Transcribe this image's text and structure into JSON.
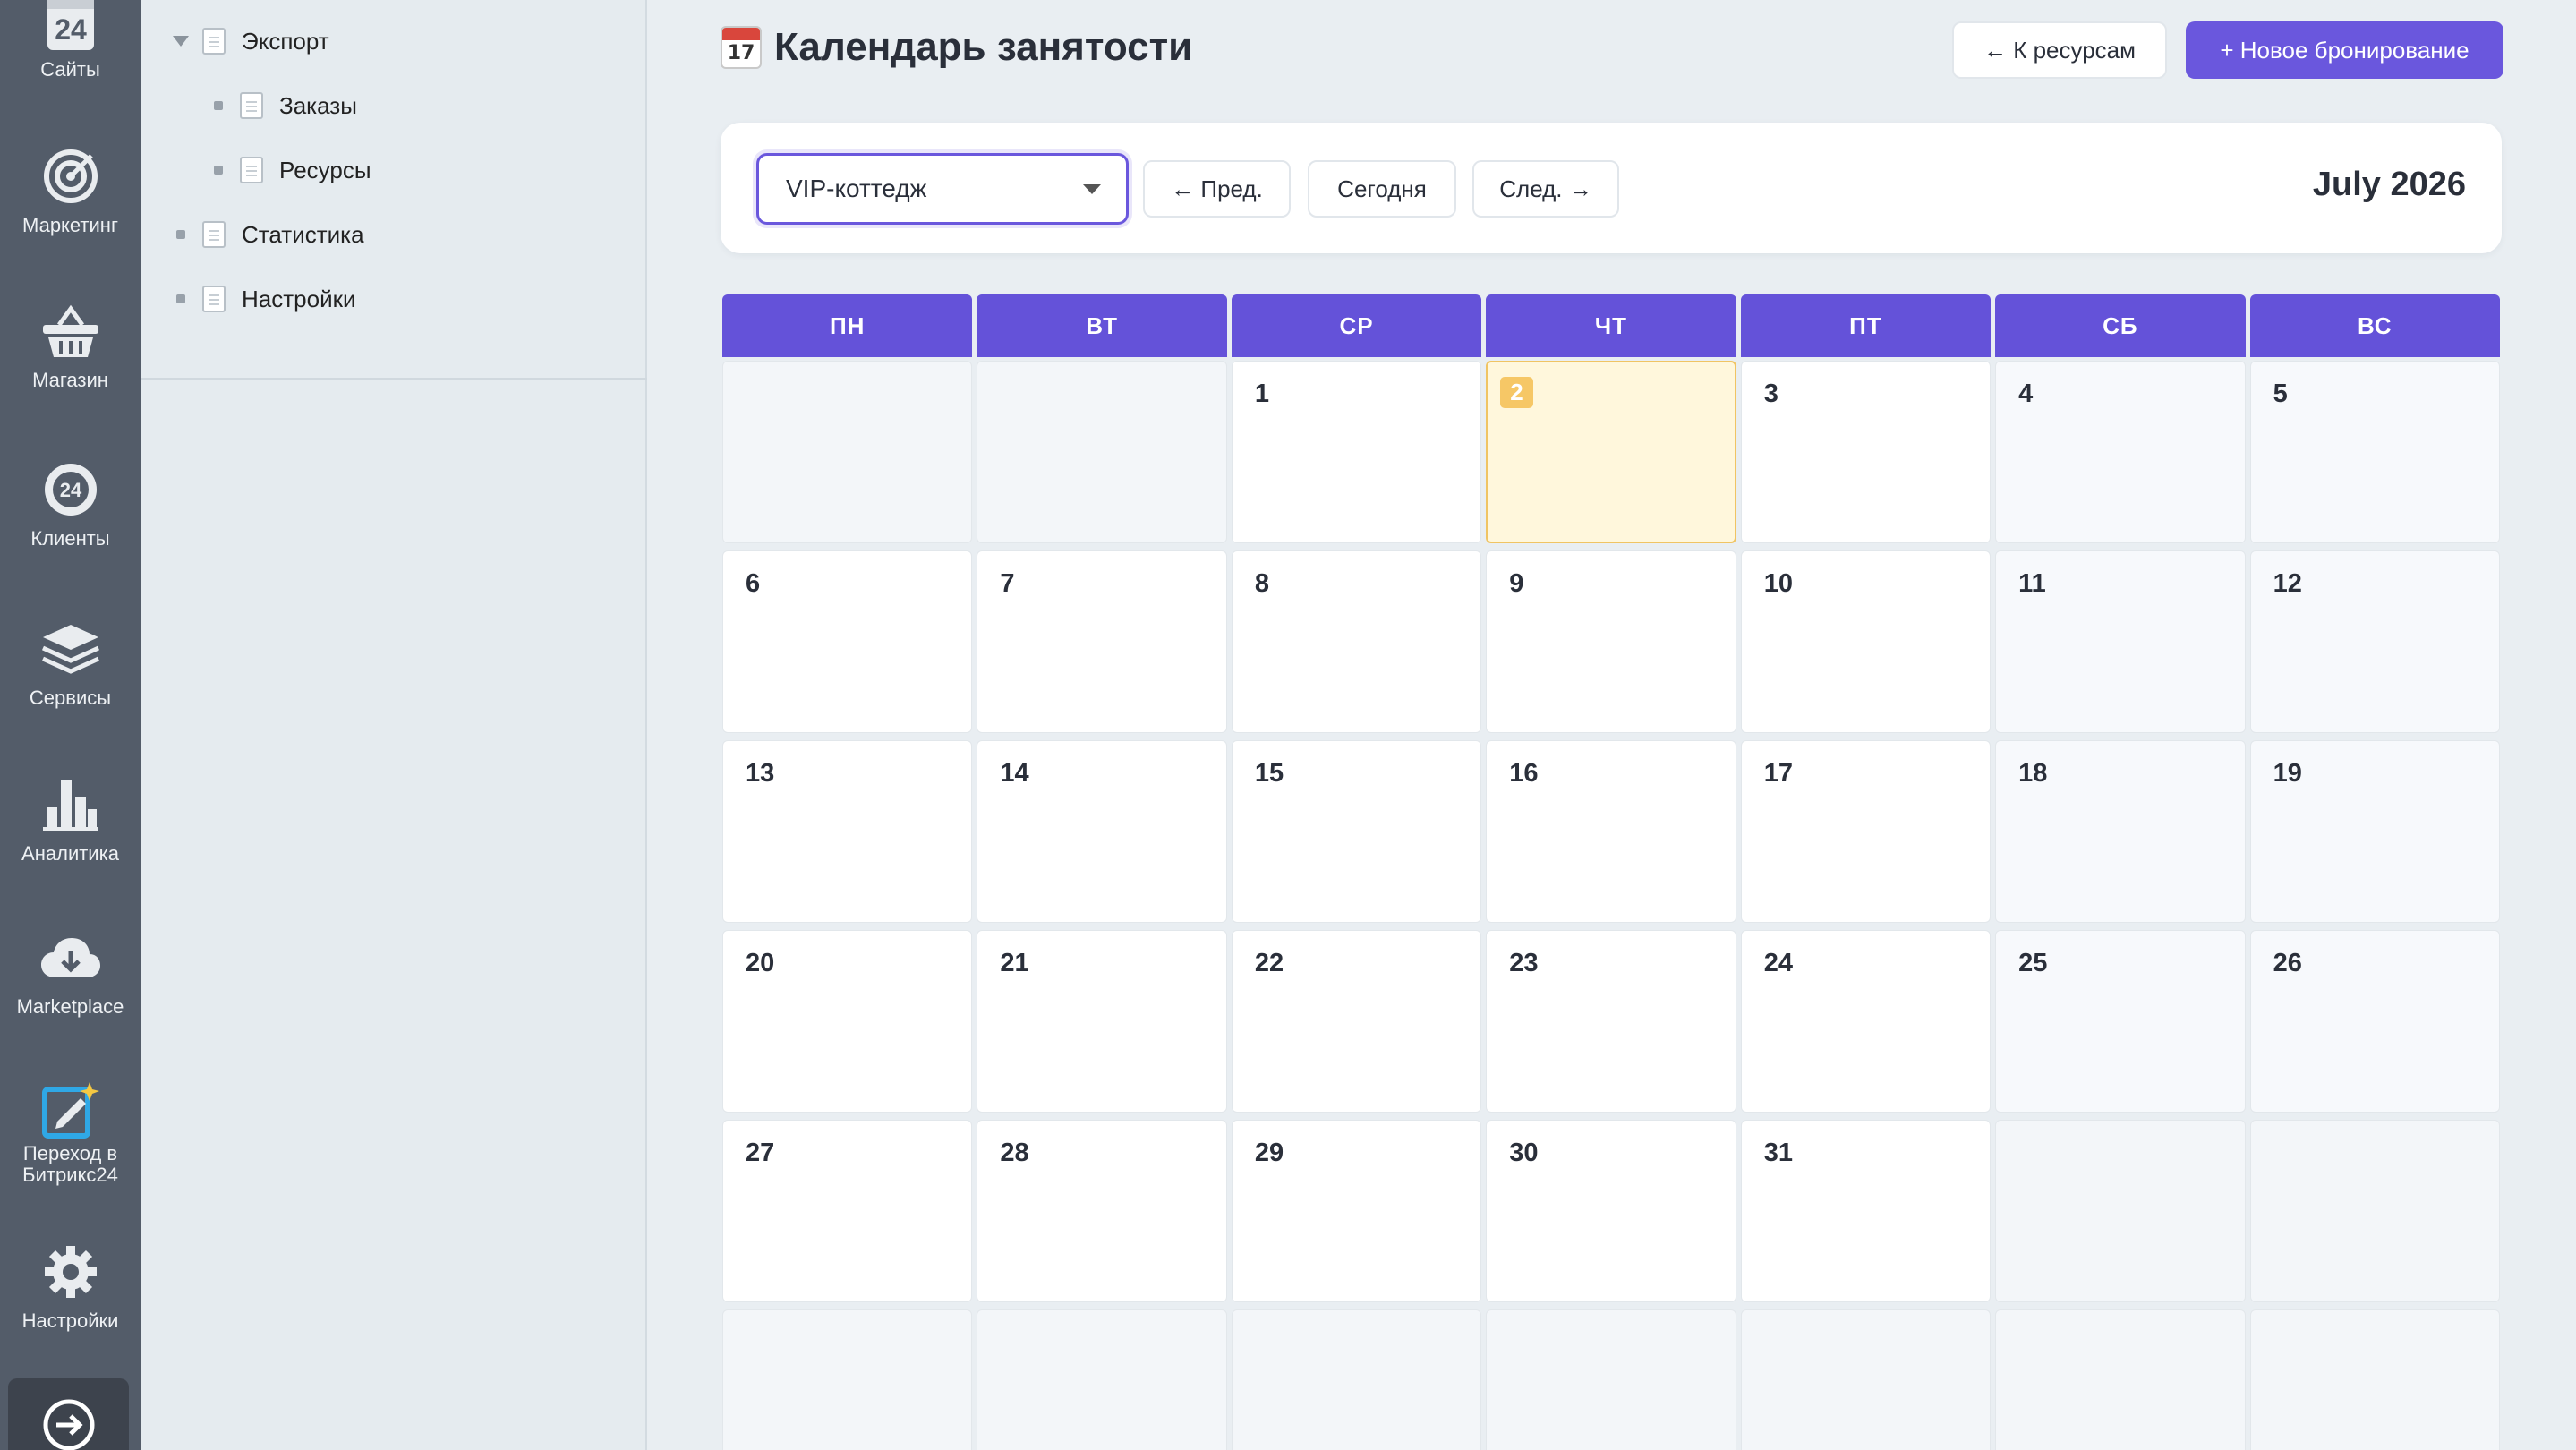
{
  "rail": {
    "items": [
      {
        "label": "Сайты",
        "icon": "calendar-24-icon"
      },
      {
        "label": "Маркетинг",
        "icon": "target-icon"
      },
      {
        "label": "Магазин",
        "icon": "basket-icon"
      },
      {
        "label": "Клиенты",
        "icon": "clients-24-icon"
      },
      {
        "label": "Сервисы",
        "icon": "layers-icon"
      },
      {
        "label": "Аналитика",
        "icon": "bar-chart-icon"
      },
      {
        "label": "Marketplace",
        "icon": "cloud-download-icon"
      },
      {
        "label": "Переход в Битрикс24",
        "icon": "edit-sparkle-icon"
      },
      {
        "label": "Настройки",
        "icon": "gear-icon"
      }
    ],
    "bottom_icon": "arrow-circle-icon",
    "icon_24": "24"
  },
  "tree": {
    "items": [
      {
        "label": "Экспорт"
      },
      {
        "label": "Заказы"
      },
      {
        "label": "Ресурсы"
      },
      {
        "label": "Статистика"
      },
      {
        "label": "Настройки"
      }
    ]
  },
  "header": {
    "title": "Календарь занятости",
    "title_icon_day": "17",
    "back_button": "← К ресурсам",
    "new_booking_button": "+ Новое бронирование"
  },
  "toolbar": {
    "resource_selected": "VIP-коттедж",
    "prev_label": "← Пред.",
    "today_label": "Сегодня",
    "next_label": "След. →",
    "month_label": "July 2026"
  },
  "calendar": {
    "weekdays": [
      "ПН",
      "ВТ",
      "СР",
      "ЧТ",
      "ПТ",
      "СБ",
      "ВС"
    ],
    "weeks": [
      [
        "",
        "",
        "1",
        "2",
        "3",
        "4",
        "5"
      ],
      [
        "6",
        "7",
        "8",
        "9",
        "10",
        "11",
        "12"
      ],
      [
        "13",
        "14",
        "15",
        "16",
        "17",
        "18",
        "19"
      ],
      [
        "20",
        "21",
        "22",
        "23",
        "24",
        "25",
        "26"
      ],
      [
        "27",
        "28",
        "29",
        "30",
        "31",
        "",
        ""
      ],
      [
        "",
        "",
        "",
        "",
        "",
        "",
        ""
      ]
    ],
    "today": "2"
  },
  "colors": {
    "accent": "#6a57dd",
    "header": "#6452d9",
    "today_bg": "#fff7dc",
    "today_badge": "#f6c766",
    "rail": "#535c69"
  }
}
